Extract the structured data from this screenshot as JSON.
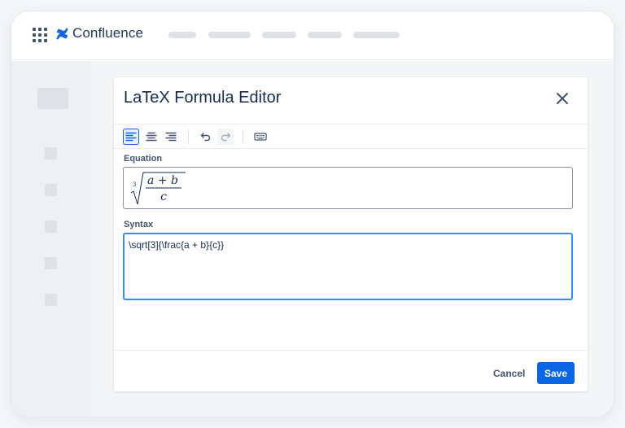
{
  "app": {
    "name": "Confluence",
    "brand_color": "#1868db"
  },
  "modal": {
    "title": "LaTeX Formula Editor",
    "close_icon": "close-icon"
  },
  "toolbar": {
    "buttons": [
      {
        "name": "align-left",
        "icon": "align-left-icon",
        "active": true
      },
      {
        "name": "align-center",
        "icon": "align-center-icon",
        "active": false
      },
      {
        "name": "align-right",
        "icon": "align-right-icon",
        "active": false
      },
      {
        "name": "undo",
        "icon": "undo-icon",
        "active": false
      },
      {
        "name": "redo",
        "icon": "redo-icon",
        "disabled": true
      },
      {
        "name": "keyboard",
        "icon": "keyboard-icon",
        "active": false
      }
    ]
  },
  "equation": {
    "label": "Equation",
    "root_index": "3",
    "numerator": "a + b",
    "denominator": "c"
  },
  "syntax": {
    "label": "Syntax",
    "value": "\\sqrt[3]{\\frac{a + b}{c}}"
  },
  "footer": {
    "cancel_label": "Cancel",
    "save_label": "Save"
  },
  "colors": {
    "primary": "#0c66e4",
    "focus_border": "#388bff",
    "text": "#172b4d"
  }
}
